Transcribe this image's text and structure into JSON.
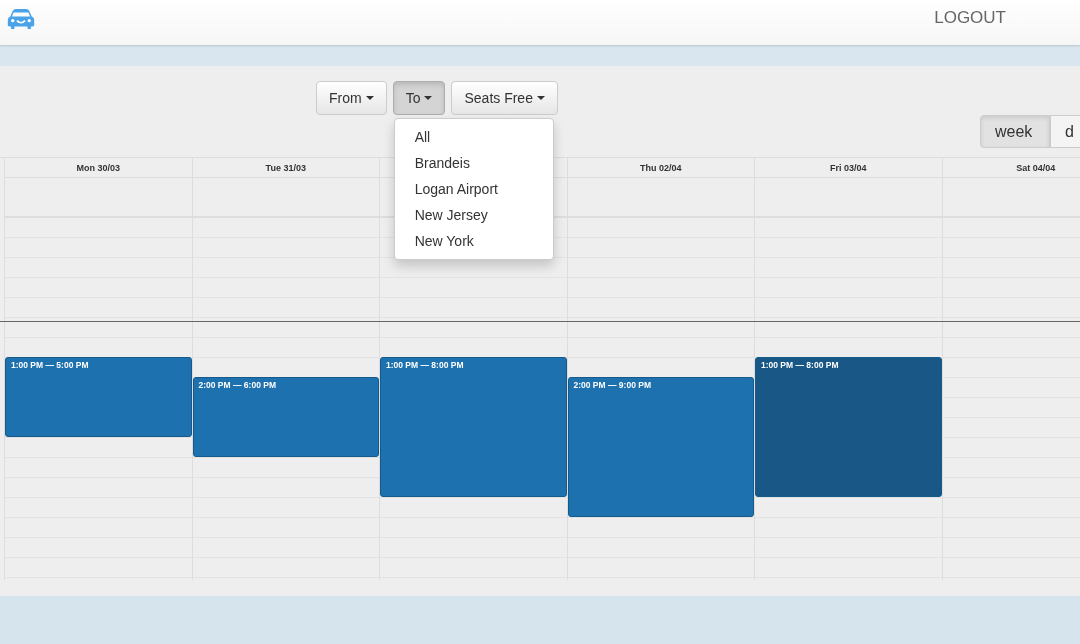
{
  "header": {
    "logout": "LOGOUT"
  },
  "filters": [
    {
      "label": "From",
      "selected": false
    },
    {
      "label": "To",
      "selected": true
    },
    {
      "label": "Seats Free",
      "selected": false
    }
  ],
  "dropdown": {
    "items": [
      "All",
      "Brandeis",
      "Logan Airport",
      "New Jersey",
      "New York"
    ]
  },
  "views": [
    {
      "label": "week",
      "selected": true
    },
    {
      "label": "d",
      "selected": false
    }
  ],
  "days": [
    {
      "label": "Mon 30/03",
      "event": {
        "time": "1:00 PM — 5:00 PM",
        "color": "#1d71ae"
      }
    },
    {
      "label": "Tue 31/03",
      "event": {
        "time": "2:00 PM — 6:00 PM",
        "color": "#1d71ae"
      }
    },
    {
      "event": {
        "time": "1:00 PM — 8:00 PM",
        "color": "#1d71ae"
      }
    },
    {
      "label": "Thu 02/04",
      "event": {
        "time": "2:00 PM — 9:00 PM",
        "color": "#1d71ae"
      }
    },
    {
      "label": "Fri 03/04",
      "event": {
        "time": "1:00 PM — 8:00 PM",
        "color": "#185786"
      }
    },
    {
      "label": "Sat 04/04"
    }
  ]
}
